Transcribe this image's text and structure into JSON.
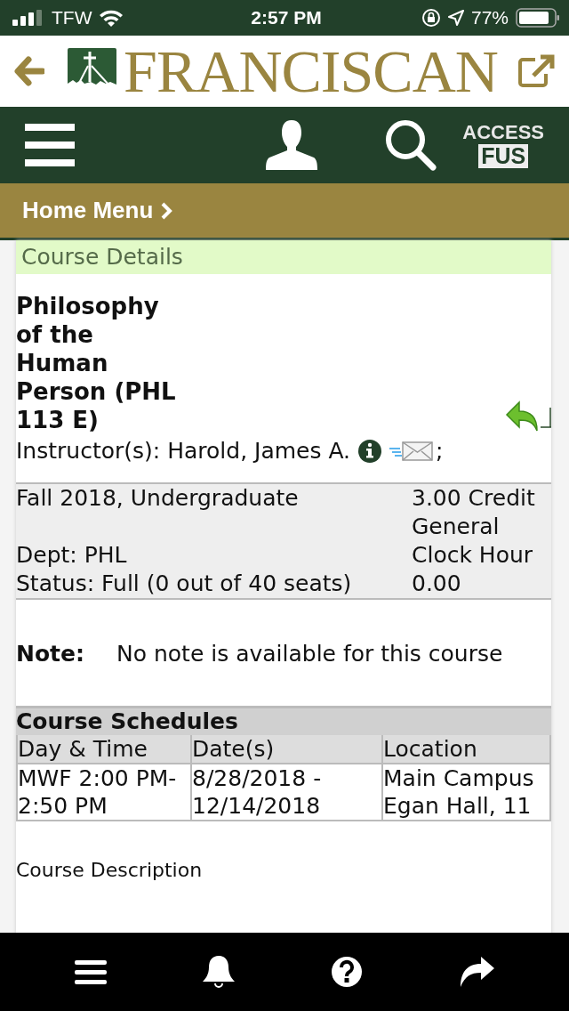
{
  "status_bar": {
    "carrier": "TFW",
    "time": "2:57 PM",
    "battery": "77%"
  },
  "header": {
    "logo": "FRANCISCAN",
    "access_top": "ACCESS",
    "access_bottom": "FUS"
  },
  "breadcrumb": {
    "label": "Home Menu"
  },
  "section_title": "Course Details",
  "course": {
    "title": "Philosophy of the Human Person (PHL 113 E)",
    "instructor": "Instructor(s): Harold, James A.",
    "instructor_suffix": ";"
  },
  "info": {
    "term": "Fall 2018, Undergraduate",
    "dept": "Dept: PHL",
    "status": "Status: Full (0 out of 40 seats)",
    "credits": "3.00 Credit",
    "type": "General",
    "clock_label": "Clock Hour",
    "clock_value": "0.00"
  },
  "note": {
    "label": "Note:",
    "text": "No note is available for this course"
  },
  "schedules": {
    "title": "Course Schedules",
    "columns": [
      "Day & Time",
      "Date(s)",
      "Location"
    ],
    "rows": [
      [
        "MWF 2:00 PM-2:50 PM",
        "8/28/2018 - 12/14/2018",
        "Main Campus Egan Hall, 11"
      ]
    ]
  },
  "description_heading": "Course Description"
}
